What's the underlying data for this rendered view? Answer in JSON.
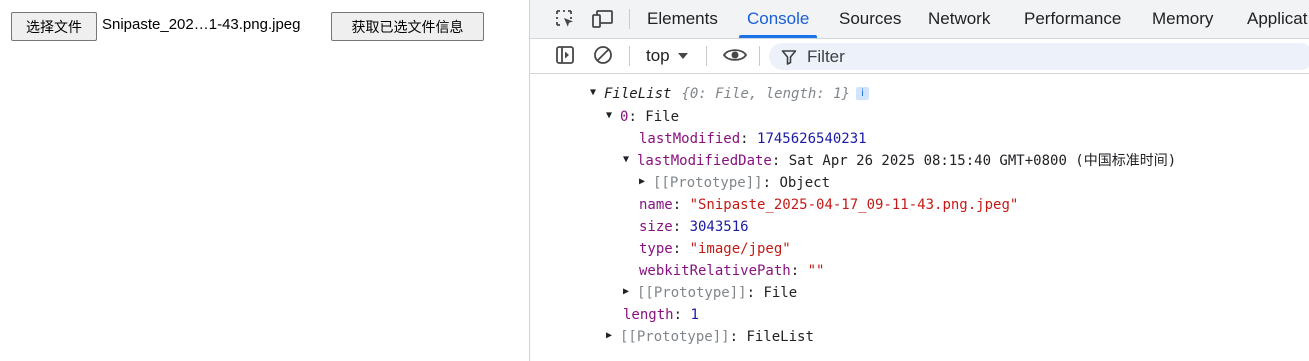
{
  "page": {
    "choose_file_button": "选择文件",
    "file_name": "Snipaste_202…1-43.png.jpeg",
    "get_info_button": "获取已选文件信息"
  },
  "devtools": {
    "tabs": [
      {
        "label": "Elements"
      },
      {
        "label": "Console",
        "active": true
      },
      {
        "label": "Sources"
      },
      {
        "label": "Network"
      },
      {
        "label": "Performance"
      },
      {
        "label": "Memory"
      },
      {
        "label": "Applicat"
      }
    ],
    "toolbar": {
      "context": "top",
      "filter_placeholder": "Filter"
    },
    "icons": [
      "inspect-element-icon",
      "device-toggle-icon",
      "sidebar-toggle-icon",
      "clear-console-icon",
      "dropdown-arrow-icon",
      "eye-icon",
      "filter-funnel-icon",
      "info-icon"
    ]
  },
  "console": {
    "filelist_label": "FileList",
    "filelist_preview": "{0: File, length: 1}",
    "info_badge": "i",
    "item0_key": "0",
    "item0_type": "File",
    "lastModified_key": "lastModified",
    "lastModified_value": "1745626540231",
    "lastModifiedDate_key": "lastModifiedDate",
    "lastModifiedDate_value": "Sat Apr 26 2025 08:15:40 GMT+0800 (中国标准时间)",
    "date_proto_key": "[[Prototype]]",
    "date_proto_value": "Object",
    "name_key": "name",
    "name_value": "\"Snipaste_2025-04-17_09-11-43.png.jpeg\"",
    "size_key": "size",
    "size_value": "3043516",
    "type_key": "type",
    "type_value": "\"image/jpeg\"",
    "webkitRelativePath_key": "webkitRelativePath",
    "webkitRelativePath_value": "\"\"",
    "file_proto_key": "[[Prototype]]",
    "file_proto_value": "File",
    "length_key": "length",
    "length_value": "1",
    "list_proto_key": "[[Prototype]]",
    "list_proto_value": "FileList",
    "colon": ": "
  }
}
